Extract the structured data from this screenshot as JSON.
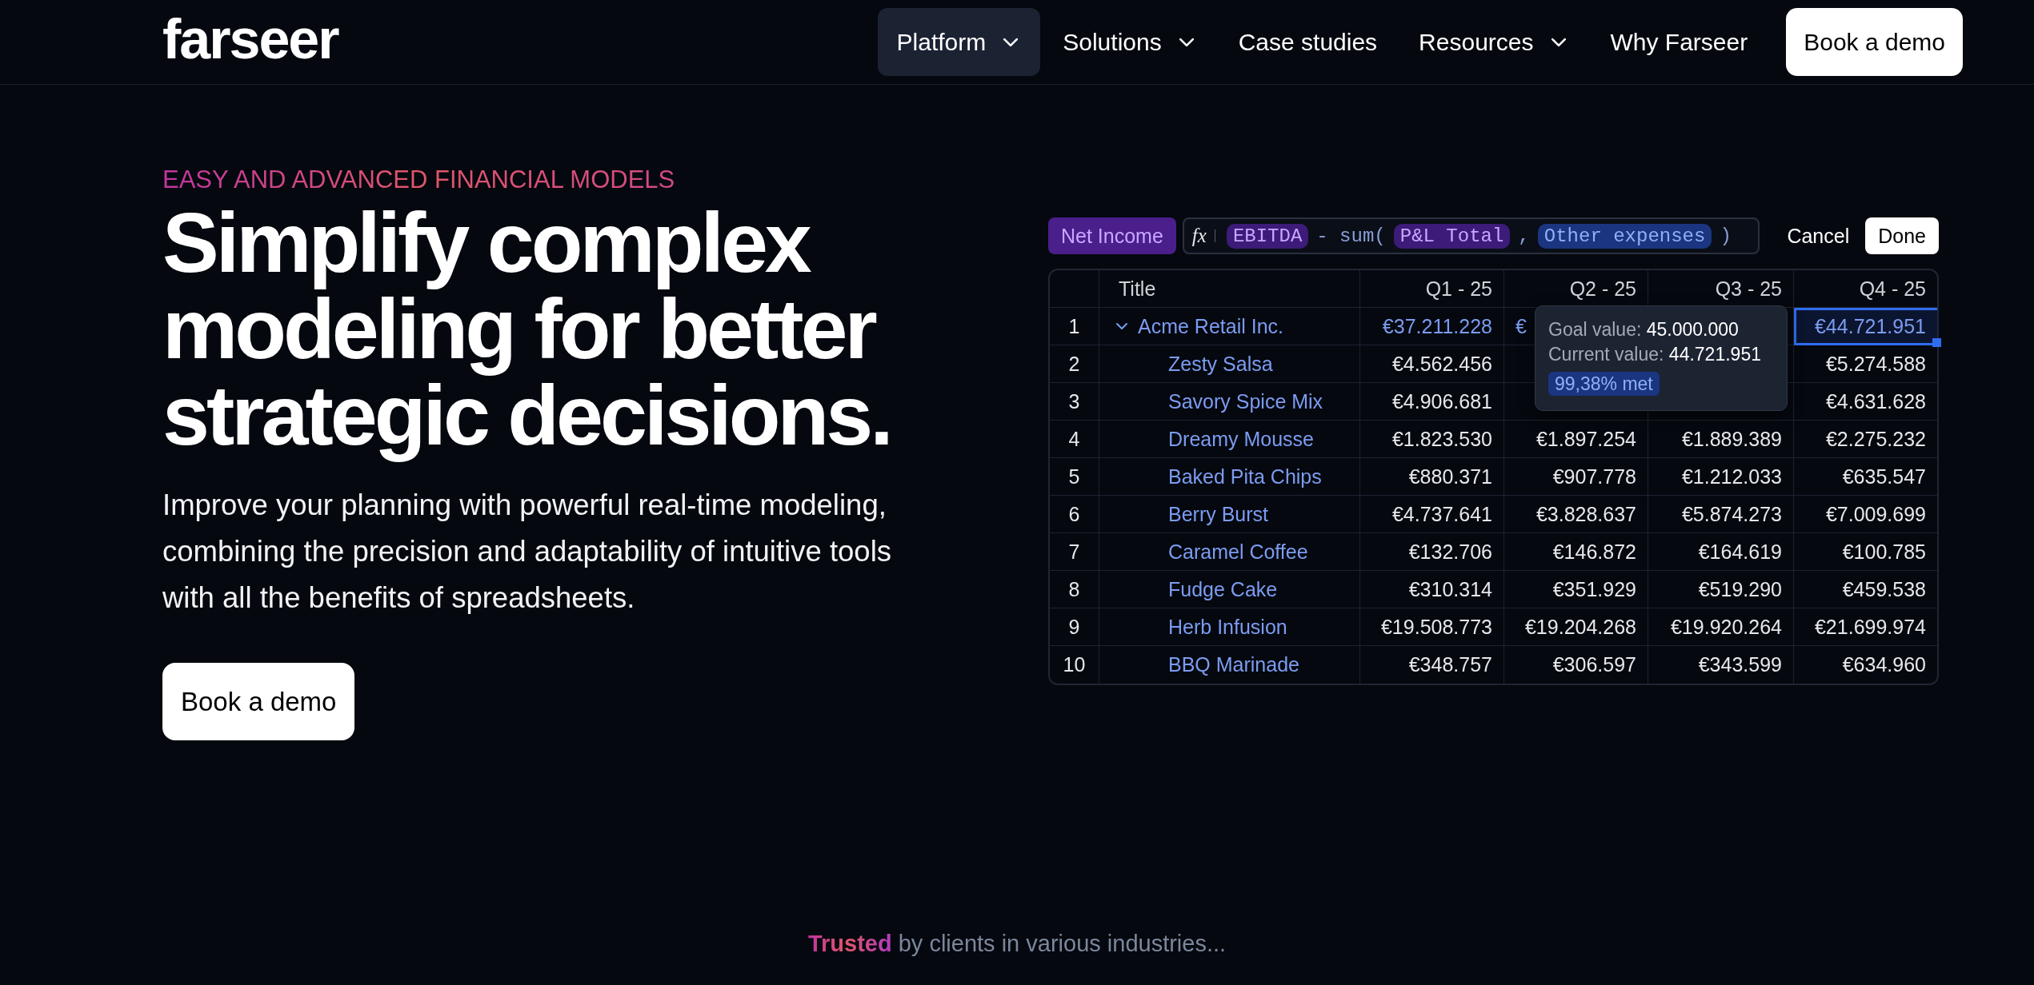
{
  "header": {
    "logo": "farseer",
    "nav": [
      {
        "label": "Platform",
        "selected": true,
        "dropdown": true
      },
      {
        "label": "Solutions",
        "selected": false,
        "dropdown": true
      },
      {
        "label": "Case studies",
        "selected": false,
        "dropdown": false
      },
      {
        "label": "Resources",
        "selected": false,
        "dropdown": true
      },
      {
        "label": "Why Farseer",
        "selected": false,
        "dropdown": false
      }
    ],
    "cta": "Book a demo"
  },
  "hero": {
    "eyebrow": "EASY AND ADVANCED FINANCIAL MODELS",
    "headline": "Simplify complex modeling for better strategic decisions.",
    "body": "Improve your planning with powerful real-time modeling, combining the precision and adaptability of intuitive tools with all the benefits of spreadsheets.",
    "cta": "Book a demo"
  },
  "sheet": {
    "formula": {
      "target": "Net Income",
      "icon_text": "fx",
      "tokens": [
        {
          "kind": "ref",
          "text": "EBITDA",
          "color": "#3d1b78"
        },
        {
          "kind": "op",
          "text": "- sum("
        },
        {
          "kind": "ref",
          "text": "P&L Total",
          "color": "#3d1b78"
        },
        {
          "kind": "op",
          "text": ","
        },
        {
          "kind": "ref",
          "text": "Other expenses",
          "color": "#1b3580"
        },
        {
          "kind": "op",
          "text": ")"
        }
      ],
      "cancel": "Cancel",
      "done": "Done"
    },
    "title_column": "Title",
    "columns": [
      "Q1 - 25",
      "Q2 - 25",
      "Q3 - 25",
      "Q4 - 25"
    ],
    "rows": [
      {
        "num": "1",
        "kind": "group",
        "expanded": true,
        "title": "Acme Retail Inc.",
        "cells": [
          {
            "text": "€37.211.228",
            "selected": false
          },
          {
            "text": "€",
            "selected": false
          },
          {
            "text": null,
            "selected": false
          },
          {
            "text": "€44.721.951",
            "selected": true
          }
        ]
      },
      {
        "num": "2",
        "kind": "item",
        "title": "Zesty Salsa",
        "cells": [
          {
            "text": "€4.562.456",
            "selected": false
          },
          {
            "text": null,
            "selected": false
          },
          {
            "text": null,
            "selected": false
          },
          {
            "text": "€5.274.588",
            "selected": false
          }
        ]
      },
      {
        "num": "3",
        "kind": "item",
        "title": "Savory Spice Mix",
        "cells": [
          {
            "text": "€4.906.681",
            "selected": false
          },
          {
            "text": null,
            "selected": false
          },
          {
            "text": null,
            "selected": false
          },
          {
            "text": "€4.631.628",
            "selected": false
          }
        ]
      },
      {
        "num": "4",
        "kind": "item",
        "title": "Dreamy Mousse",
        "cells": [
          {
            "text": "€1.823.530",
            "selected": false
          },
          {
            "text": "€1.897.254",
            "selected": false
          },
          {
            "text": "€1.889.389",
            "selected": false
          },
          {
            "text": "€2.275.232",
            "selected": false
          }
        ]
      },
      {
        "num": "5",
        "kind": "item",
        "title": "Baked Pita Chips",
        "cells": [
          {
            "text": "€880.371",
            "selected": false
          },
          {
            "text": "€907.778",
            "selected": false
          },
          {
            "text": "€1.212.033",
            "selected": false
          },
          {
            "text": "€635.547",
            "selected": false
          }
        ]
      },
      {
        "num": "6",
        "kind": "item",
        "title": "Berry Burst",
        "cells": [
          {
            "text": "€4.737.641",
            "selected": false
          },
          {
            "text": "€3.828.637",
            "selected": false
          },
          {
            "text": "€5.874.273",
            "selected": false
          },
          {
            "text": "€7.009.699",
            "selected": false
          }
        ]
      },
      {
        "num": "7",
        "kind": "item",
        "title": "Caramel Coffee",
        "cells": [
          {
            "text": "€132.706",
            "selected": false
          },
          {
            "text": "€146.872",
            "selected": false
          },
          {
            "text": "€164.619",
            "selected": false
          },
          {
            "text": "€100.785",
            "selected": false
          }
        ]
      },
      {
        "num": "8",
        "kind": "item",
        "title": "Fudge Cake",
        "cells": [
          {
            "text": "€310.314",
            "selected": false
          },
          {
            "text": "€351.929",
            "selected": false
          },
          {
            "text": "€519.290",
            "selected": false
          },
          {
            "text": "€459.538",
            "selected": false
          }
        ]
      },
      {
        "num": "9",
        "kind": "item",
        "title": "Herb Infusion",
        "cells": [
          {
            "text": "€19.508.773",
            "selected": false
          },
          {
            "text": "€19.204.268",
            "selected": false
          },
          {
            "text": "€19.920.264",
            "selected": false
          },
          {
            "text": "€21.699.974",
            "selected": false
          }
        ]
      },
      {
        "num": "10",
        "kind": "item",
        "title": "BBQ Marinade",
        "cells": [
          {
            "text": "€348.757",
            "selected": false
          },
          {
            "text": "€306.597",
            "selected": false
          },
          {
            "text": "€343.599",
            "selected": false
          },
          {
            "text": "€634.960",
            "selected": false
          }
        ]
      }
    ],
    "tooltip": {
      "goal_label": "Goal value:",
      "goal_value": "45.000.000",
      "current_label": "Current value:",
      "current_value": "44.721.951",
      "badge": "99,38% met"
    }
  },
  "trusted": "**Trusted** by clients in various industries..."
}
